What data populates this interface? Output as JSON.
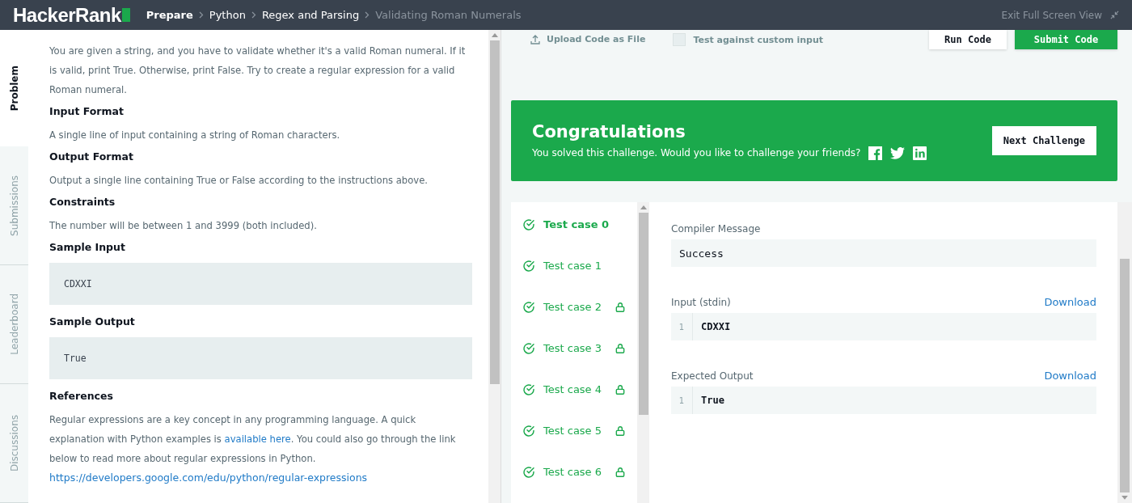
{
  "header": {
    "logo": "HackerRank",
    "breadcrumbs": [
      {
        "label": "Prepare",
        "kind": "root"
      },
      {
        "label": "Python",
        "kind": "link"
      },
      {
        "label": "Regex and Parsing",
        "kind": "link"
      },
      {
        "label": "Validating Roman Numerals",
        "kind": "current"
      }
    ],
    "exit_label": "Exit Full Screen View"
  },
  "sidebar_tabs": [
    {
      "label": "Problem",
      "selected": true
    },
    {
      "label": "Submissions",
      "selected": false
    },
    {
      "label": "Leaderboard",
      "selected": false
    },
    {
      "label": "Discussions",
      "selected": false
    }
  ],
  "problem": [
    {
      "kind": "paragraph",
      "text": "You are given a string, and you have to validate whether it's a valid Roman numeral. If it is valid, print True. Otherwise, print False. Try to create a regular expression for a valid Roman numeral."
    },
    {
      "kind": "heading",
      "text": "Input Format"
    },
    {
      "kind": "paragraph",
      "text": "A single line of input containing a string of Roman characters."
    },
    {
      "kind": "heading",
      "text": "Output Format"
    },
    {
      "kind": "paragraph",
      "text": "Output a single line containing True or False according to the instructions above."
    },
    {
      "kind": "heading",
      "text": "Constraints"
    },
    {
      "kind": "paragraph",
      "text": "The number will be between 1 and 3999 (both included)."
    },
    {
      "kind": "heading",
      "text": "Sample Input"
    },
    {
      "kind": "code",
      "text": "CDXXI"
    },
    {
      "kind": "heading",
      "text": "Sample Output"
    },
    {
      "kind": "code",
      "text": "True"
    },
    {
      "kind": "heading",
      "text": "References"
    },
    {
      "kind": "linked",
      "before": "Regular expressions are a key concept in any programming language. A quick explanation with Python examples is ",
      "link": "available here",
      "after": ". You could also go through the link below to read more about regular expressions in Python."
    },
    {
      "kind": "url",
      "text": "https://developers.google.com/edu/python/regular-expressions"
    }
  ],
  "toolbar": {
    "upload_label": "Upload Code as File",
    "custom_input": {
      "label": "Test against custom input",
      "checked": false
    },
    "buttons": [
      {
        "label": "Run Code",
        "kind": "secondary"
      },
      {
        "label": "Submit Code",
        "kind": "primary"
      }
    ]
  },
  "banner": {
    "title": "Congratulations",
    "message": "You solved this challenge. Would you like to challenge your friends?",
    "next_button": "Next Challenge"
  },
  "test_cases": [
    {
      "label": "Test case 0",
      "selected": true,
      "passed": true,
      "locked": false
    },
    {
      "label": "Test case 1",
      "selected": false,
      "passed": true,
      "locked": false
    },
    {
      "label": "Test case 2",
      "selected": false,
      "passed": true,
      "locked": true
    },
    {
      "label": "Test case 3",
      "selected": false,
      "passed": true,
      "locked": true
    },
    {
      "label": "Test case 4",
      "selected": false,
      "passed": true,
      "locked": true
    },
    {
      "label": "Test case 5",
      "selected": false,
      "passed": true,
      "locked": true
    },
    {
      "label": "Test case 6",
      "selected": false,
      "passed": true,
      "locked": true
    }
  ],
  "details": {
    "compiler_label": "Compiler Message",
    "compiler_message": "Success",
    "sections": [
      {
        "label": "Input (stdin)",
        "download": "Download",
        "lines": [
          {
            "number": "1",
            "text": "CDXXI"
          }
        ]
      },
      {
        "label": "Expected Output",
        "download": "Download",
        "lines": [
          {
            "number": "1",
            "text": "True"
          }
        ]
      }
    ]
  }
}
